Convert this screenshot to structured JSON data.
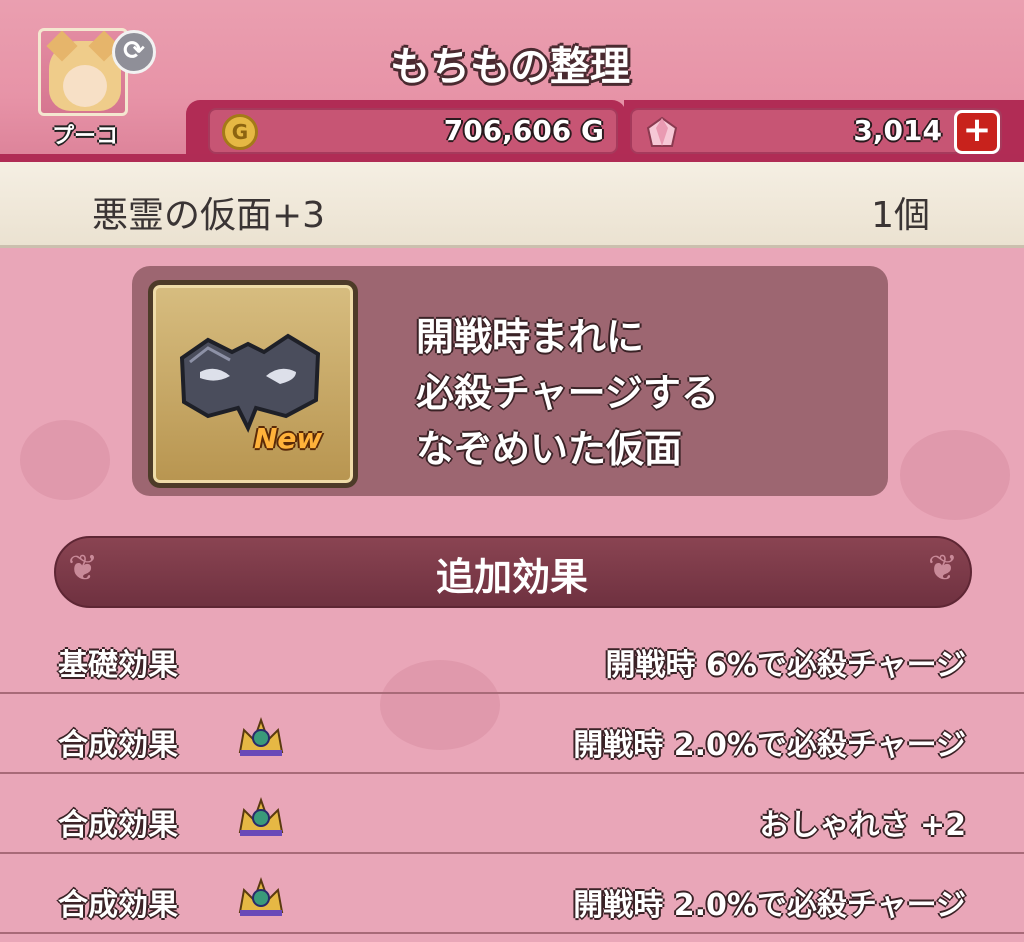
{
  "header": {
    "title": "もちもの整理",
    "character_name": "プーコ",
    "gold": "706,606 G",
    "gems": "3,014",
    "coin_symbol": "G",
    "plus_symbol": "+"
  },
  "item": {
    "name": "悪霊の仮面+3",
    "count": "1個",
    "badge": "New",
    "description_lines": [
      "開戦時まれに",
      "必殺チャージする",
      "なぞめいた仮面"
    ]
  },
  "effects_section": {
    "title": "追加効果",
    "rows": [
      {
        "label": "基礎効果",
        "value": "開戦時 6%で必殺チャージ",
        "has_crown": false
      },
      {
        "label": "合成効果",
        "value": "開戦時 2.0%で必殺チャージ",
        "has_crown": true
      },
      {
        "label": "合成効果",
        "value": "おしゃれさ +2",
        "has_crown": true
      },
      {
        "label": "合成効果",
        "value": "開戦時 2.0%で必殺チャージ",
        "has_crown": true
      }
    ]
  },
  "colors": {
    "background": "#e9a6b8",
    "header_band": "#b02c55",
    "banner": "#7a3848",
    "gold_coin": "#e6b844"
  },
  "icons": [
    "avatar",
    "swap-icon",
    "coin-icon",
    "gem-icon",
    "plus-icon",
    "mask-icon",
    "crown-icon"
  ]
}
